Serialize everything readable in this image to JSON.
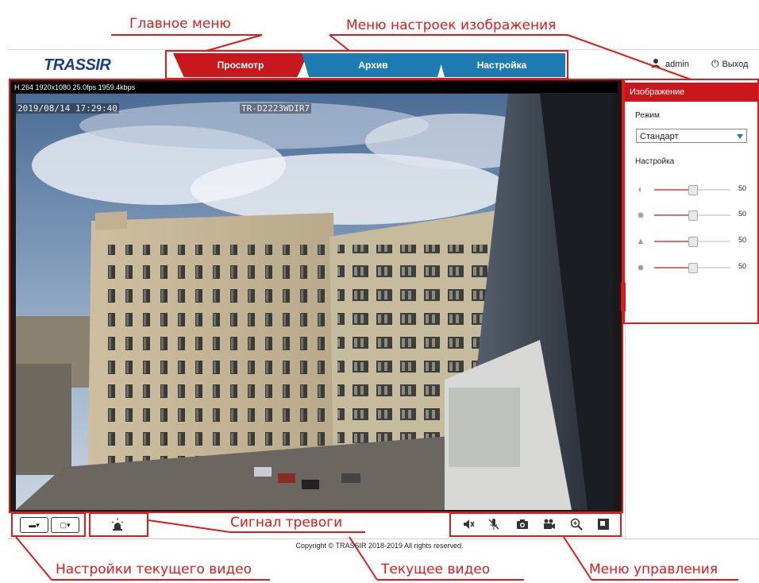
{
  "annotations": {
    "main_menu": "Главное меню",
    "image_settings_menu": "Меню настроек изображения",
    "alarm_signal": "Сигнал тревоги",
    "current_video_settings": "Настройки текущего видео",
    "current_video": "Текущее видео",
    "control_menu": "Меню управления"
  },
  "header": {
    "logo": "TRASSIR",
    "tabs": [
      {
        "label": "Просмотр",
        "active": true,
        "color": "#c8181e"
      },
      {
        "label": "Архив",
        "active": false,
        "color": "#1c7bb0"
      },
      {
        "label": "Настройка",
        "active": false,
        "color": "#1c7bb0"
      }
    ],
    "user": "admin",
    "logout": "Выход",
    "icons": {
      "user": "user-icon",
      "logout": "power-icon"
    }
  },
  "video": {
    "stream_info": "H.264 1920x1080 25.0fps 1959.4kbps",
    "osd_datetime": "2019/08/14 17:29:40",
    "osd_camera": "TR-D2223WDIR7"
  },
  "toolbar": {
    "left_icons": [
      "stream-select-icon",
      "layout-select-icon",
      "alarm-light-icon"
    ],
    "control_icons": [
      "mute-icon",
      "mic-off-icon",
      "snapshot-icon",
      "record-icon",
      "zoom-in-icon",
      "fullscreen-icon"
    ]
  },
  "side_panel": {
    "title": "Изображение",
    "mode_label": "Режим",
    "mode_value": "Стандарт",
    "settings_label": "Настройка",
    "sliders": [
      {
        "icon": "brightness-icon",
        "value": 50
      },
      {
        "icon": "contrast-icon",
        "value": 50
      },
      {
        "icon": "sharpness-icon",
        "value": 50
      },
      {
        "icon": "saturation-icon",
        "value": 50
      }
    ]
  },
  "footer": {
    "copyright": "Copyright © TRASSIR 2018-2019 All rights reserved."
  }
}
